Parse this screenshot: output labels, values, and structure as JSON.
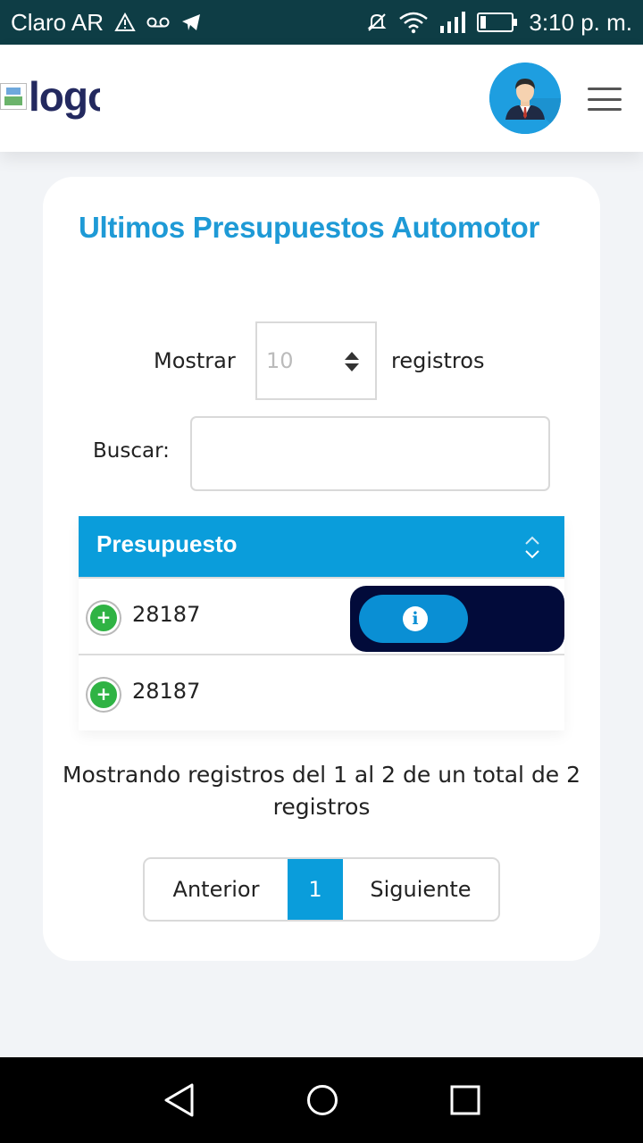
{
  "status_bar": {
    "carrier": "Claro AR",
    "time": "3:10 p. m.",
    "left_icons": [
      "warning-icon",
      "voicemail-icon",
      "telegram-icon"
    ],
    "right_icons": [
      "mute-icon",
      "wifi-icon",
      "signal-icon",
      "battery-icon"
    ]
  },
  "header": {
    "logo_alt": "logo",
    "avatar_icon": "user-avatar-icon",
    "menu_icon": "hamburger-menu-icon"
  },
  "card": {
    "title": "Ultimos Presupuestos Automotor",
    "length_menu": {
      "prefix": "Mostrar",
      "value": "10",
      "suffix": "registros"
    },
    "search": {
      "label": "Buscar:",
      "value": ""
    },
    "table": {
      "column_header": "Presupuesto",
      "rows": [
        {
          "value": "28187"
        },
        {
          "value": "28187"
        }
      ]
    },
    "info": "Mostrando registros del 1 al 2 de un total de 2 registros",
    "pagination": {
      "previous": "Anterior",
      "current": "1",
      "next": "Siguiente"
    }
  },
  "colors": {
    "accent": "#0a9ddb",
    "title": "#1e9ad6",
    "status_bar": "#0e3d45",
    "action_box": "#020b3a",
    "expand_button": "#2fb344"
  }
}
